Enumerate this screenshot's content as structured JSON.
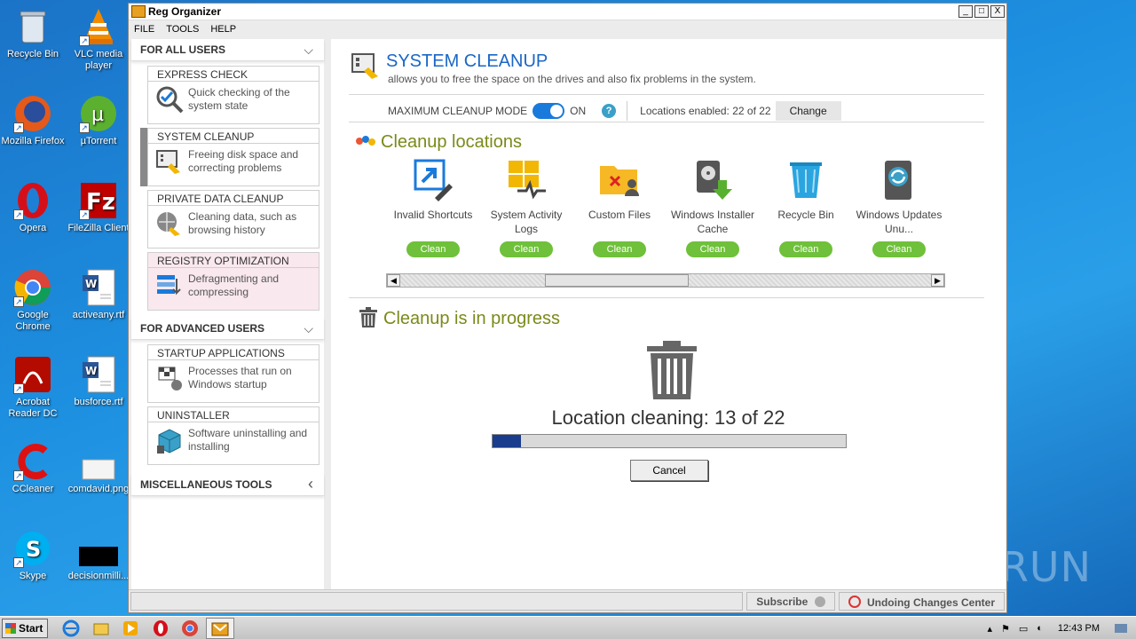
{
  "desktop": {
    "icons": [
      {
        "label": "Recycle Bin"
      },
      {
        "label": "VLC media player"
      },
      {
        "label": "Mozilla Firefox"
      },
      {
        "label": "µTorrent"
      },
      {
        "label": "Opera"
      },
      {
        "label": "FileZilla Client"
      },
      {
        "label": "Google Chrome"
      },
      {
        "label": "activeany.rtf"
      },
      {
        "label": "Acrobat Reader DC"
      },
      {
        "label": "busforce.rtf"
      },
      {
        "label": "CCleaner"
      },
      {
        "label": "comdavid.png"
      },
      {
        "label": "Skype"
      },
      {
        "label": "decisionmilli..."
      }
    ],
    "watermark": "ANY RUN"
  },
  "window": {
    "title": "Reg Organizer",
    "buttons": {
      "minimize": "_",
      "maximize": "□",
      "close": "X"
    }
  },
  "menu": [
    "FILE",
    "TOOLS",
    "HELP"
  ],
  "sidebar": {
    "all_users_header": "FOR ALL USERS",
    "advanced_header": "FOR ADVANCED USERS",
    "misc_header": "MISCELLANEOUS TOOLS",
    "chevron_down": "⌵",
    "chevron_left": "‹",
    "cards": [
      {
        "title": "EXPRESS CHECK",
        "desc": "Quick checking of the system state"
      },
      {
        "title": "SYSTEM CLEANUP",
        "desc": "Freeing disk space and correcting problems"
      },
      {
        "title": "PRIVATE DATA CLEANUP",
        "desc": "Cleaning data, such as browsing history"
      },
      {
        "title": "REGISTRY OPTIMIZATION",
        "desc": "Defragmenting and compressing"
      },
      {
        "title": "STARTUP APPLICATIONS",
        "desc": "Processes that run on Windows startup"
      },
      {
        "title": "UNINSTALLER",
        "desc": "Software uninstalling and installing"
      }
    ]
  },
  "main": {
    "title": "SYSTEM CLEANUP",
    "subtitle": "allows you to free the space on the drives and also fix problems in the system.",
    "mode_label": "MAXIMUM CLEANUP MODE",
    "mode_state": "ON",
    "help": "?",
    "locations_enabled": "Locations enabled: 22 of 22",
    "change_label": "Change",
    "locations_title": "Cleanup locations",
    "locations": [
      {
        "name": "Invalid Shortcuts",
        "button": "Clean"
      },
      {
        "name": "System Activity Logs",
        "button": "Clean"
      },
      {
        "name": "Custom Files",
        "button": "Clean"
      },
      {
        "name": "Windows Installer Cache",
        "button": "Clean"
      },
      {
        "name": "Recycle Bin",
        "button": "Clean"
      },
      {
        "name": "Windows Updates Unu...",
        "button": "Clean"
      }
    ],
    "scroll_left": "◀",
    "scroll_right": "▶",
    "progress_title": "Cleanup is in progress",
    "progress_text": "Location cleaning: 13 of 22",
    "progress_fraction": 0.08,
    "cancel_label": "Cancel"
  },
  "statusbar": {
    "subscribe": "Subscribe",
    "undo_center": "Undoing Changes Center"
  },
  "taskbar": {
    "start": "Start",
    "time": "12:43 PM"
  },
  "colors": {
    "accent_blue": "#1a66c7",
    "section_green": "#7b8a19",
    "clean_button": "#6fc03a",
    "progress_fill": "#1a3c8c"
  }
}
